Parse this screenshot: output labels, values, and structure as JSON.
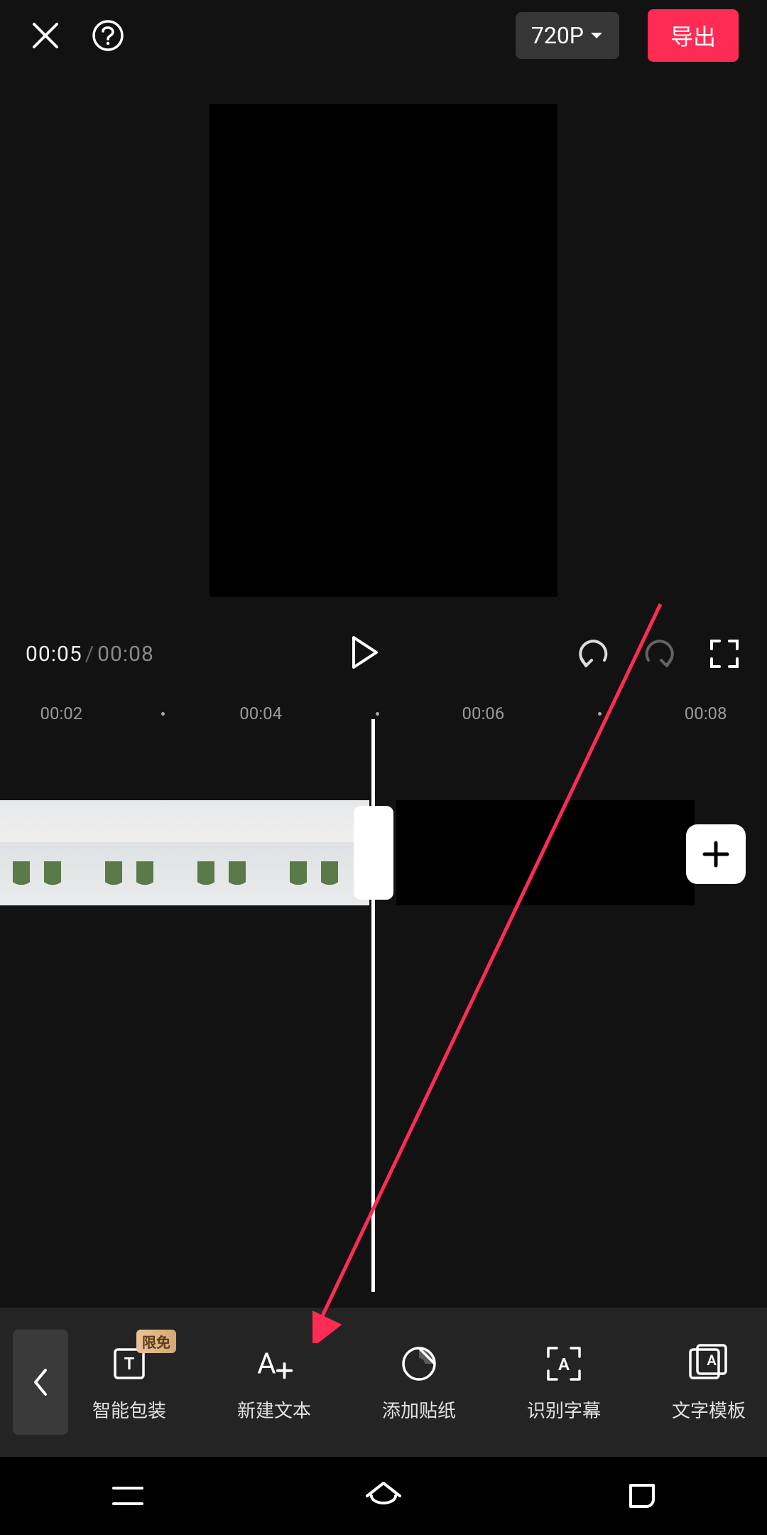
{
  "header": {
    "resolution_label": "720P",
    "export_label": "导出"
  },
  "player": {
    "current_time": "00:05",
    "total_time": "00:08",
    "ruler": [
      "00:02",
      "00:04",
      "00:06",
      "00:08"
    ]
  },
  "toolbar": {
    "badge_text": "限免",
    "items": [
      {
        "label": "智能包装",
        "icon": "smart-package-icon"
      },
      {
        "label": "新建文本",
        "icon": "new-text-icon"
      },
      {
        "label": "添加贴纸",
        "icon": "sticker-icon"
      },
      {
        "label": "识别字幕",
        "icon": "recognize-subtitle-icon"
      },
      {
        "label": "文字模板",
        "icon": "text-template-icon"
      }
    ]
  },
  "colors": {
    "accent": "#fe2c55",
    "bg": "#121212"
  }
}
